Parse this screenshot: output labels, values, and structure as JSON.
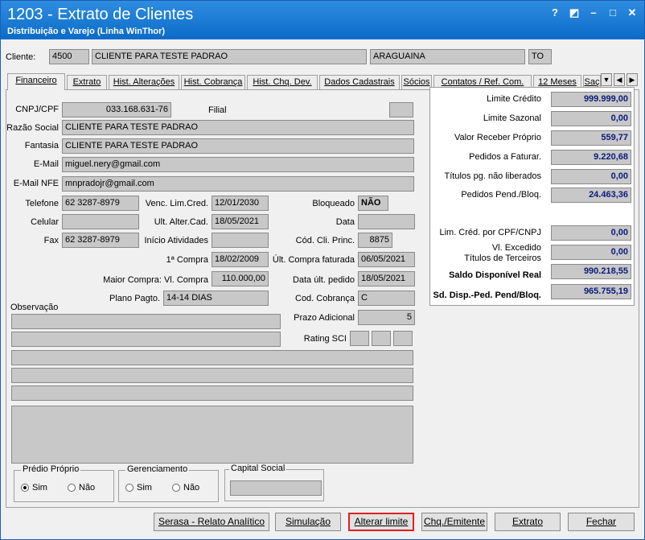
{
  "window": {
    "title": "1203 - Extrato de Clientes",
    "subtitle": "Distribuição e Varejo (Linha WinThor)",
    "controls": [
      "?",
      "◩",
      "–",
      "□",
      "✕"
    ]
  },
  "client": {
    "label": "Cliente:",
    "code": "4500",
    "name": "CLIENTE PARA TESTE PADRAO",
    "city": "ARAGUAINA",
    "state": "TO"
  },
  "tabs": [
    "Financeiro",
    "Extrato",
    "Hist. Alterações",
    "Hist. Cobrança",
    "Hist. Chq. Dev.",
    "Dados Cadastrais",
    "Sócios",
    "Contatos / Ref. Com.",
    "12 Meses",
    "Saç"
  ],
  "form": {
    "cnpj_label": "CNPJ/CPF",
    "cnpj": "033.168.631-76",
    "filial_label": "Filial",
    "filial": "",
    "razao_label": "Razão Social",
    "razao": "CLIENTE PARA TESTE PADRAO",
    "fantasia_label": "Fantasia",
    "fantasia": "CLIENTE PARA TESTE PADRAO",
    "email_label": "E-Mail",
    "email": "miguel.nery@gmail.com",
    "emailnfe_label": "E-Mail NFE",
    "emailnfe": "mnpradojr@gmail.com",
    "telefone_label": "Telefone",
    "telefone": "62 3287-8979",
    "venc_label": "Venc. Lim.Cred.",
    "venc": "12/01/2030",
    "bloqueado_label": "Bloqueado",
    "bloqueado": "NÃO",
    "celular_label": "Celular",
    "celular": "",
    "ult_alter_label": "Ult. Alter.Cad.",
    "ult_alter": "18/05/2021",
    "data_label": "Data",
    "data": "",
    "fax_label": "Fax",
    "fax": "62 3287-8979",
    "inicio_label": "Início Atividades",
    "inicio": "",
    "cod_princ_label": "Cód. Cli. Princ.",
    "cod_princ": "8875",
    "primeira_compra_label": "1ª Compra",
    "primeira_compra": "18/02/2009",
    "ult_compra_label": "Últ. Compra faturada",
    "ult_compra": "06/05/2021",
    "maior_compra_label": "Maior Compra: Vl. Compra",
    "maior_compra": "110.000,00",
    "data_ult_pedido_label": "Data últ. pedido",
    "data_ult_pedido": "18/05/2021",
    "plano_label": "Plano Pagto.",
    "plano": "14-14 DIAS",
    "cod_cobranca_label": "Cod. Cobrança",
    "cod_cobranca": "C",
    "observacao_label": "Observação",
    "prazo_label": "Prazo Adicional",
    "prazo": "5",
    "rating_label": "Rating SCI"
  },
  "limits": [
    {
      "label": "Limite Crédito",
      "value": "999.999,00"
    },
    {
      "label": "Limite Sazonal",
      "value": "0,00"
    },
    {
      "label": "Valor Receber Próprio",
      "value": "559,77"
    },
    {
      "label": "Pedidos a Faturar.",
      "value": "9.220,68"
    },
    {
      "label": "Títulos pg. não liberados",
      "value": "0,00"
    },
    {
      "label": "Pedidos Pend./Bloq.",
      "value": "24.463,36"
    },
    {
      "label": "Lim. Créd. por CPF/CNPJ",
      "value": "0,00"
    },
    {
      "label": "Vl. Excedido",
      "label2": "Títulos de Terceiros",
      "value": "0,00"
    },
    {
      "label": "Saldo Disponível Real",
      "value": "990.218,55"
    },
    {
      "label": "Sd. Disp.-Ped. Pend/Bloq.",
      "value": "965.755,19"
    }
  ],
  "groups": {
    "predio": {
      "title": "Prédio Próprio",
      "sim": "Sim",
      "nao": "Não"
    },
    "gerenciamento": {
      "title": "Gerenciamento",
      "sim": "Sim",
      "nao": "Não"
    },
    "capital": {
      "title": "Capital Social",
      "value": ""
    }
  },
  "buttons": {
    "serasa": "Serasa - Relato Analítico",
    "simulacao": "Simulação",
    "alterar": "Alterar limite",
    "chq": "Chq./Emitente",
    "extrato": "Extrato",
    "fechar": "Fechar"
  },
  "colors": {
    "titlebar": "#0b6bc8",
    "value_text": "#0a1a7a",
    "highlight": "#e02020"
  }
}
